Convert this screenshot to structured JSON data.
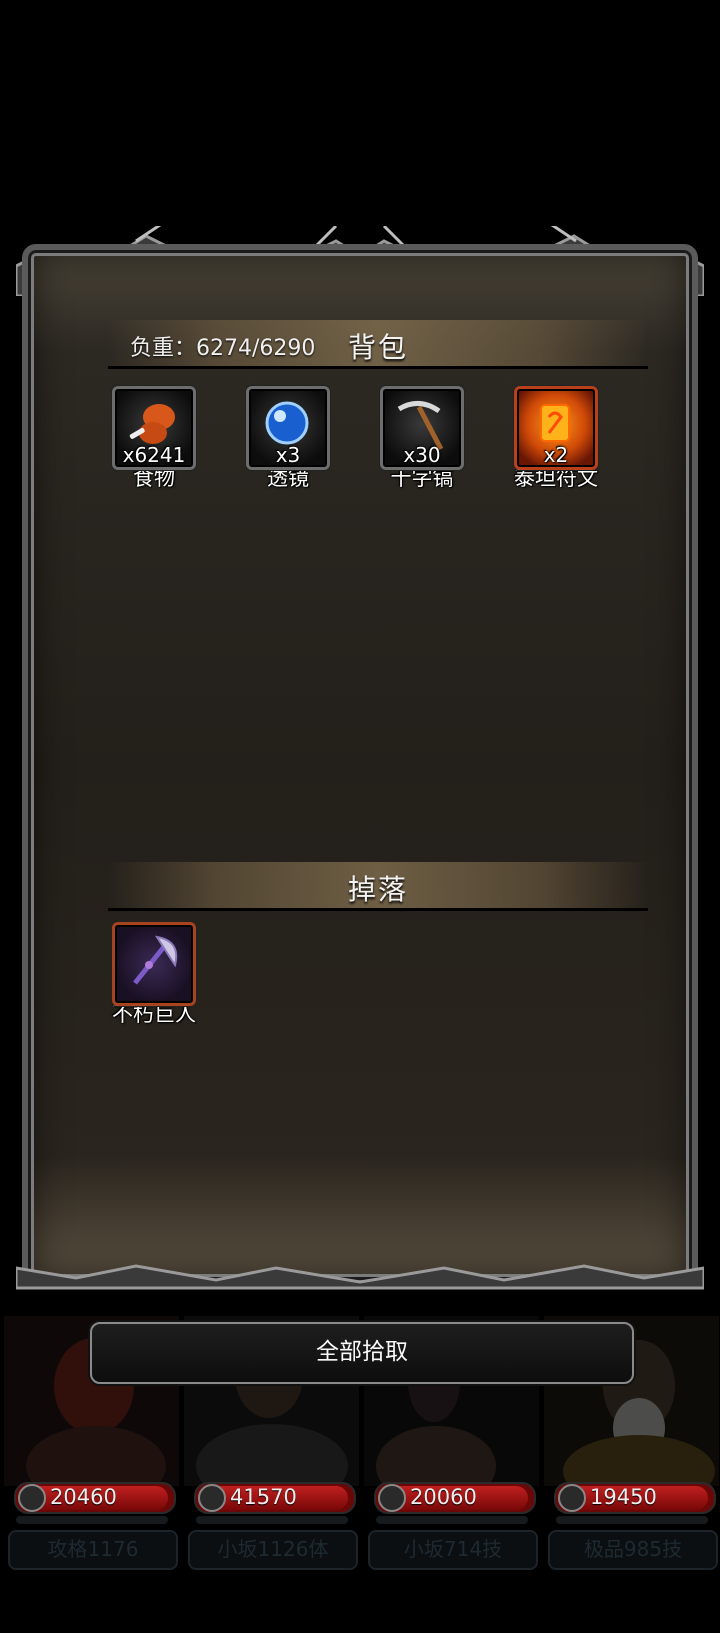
{
  "backpack": {
    "load_label": "负重：6274/6290",
    "title": "背包",
    "items": [
      {
        "name": "食物",
        "count": "x6241",
        "icon": "drumstick-icon"
      },
      {
        "name": "透镜",
        "count": "x3",
        "icon": "lens-orb-icon"
      },
      {
        "name": "十字镐",
        "count": "x30",
        "icon": "pickaxe-icon"
      },
      {
        "name": "泰坦符文",
        "count": "x2",
        "icon": "rune-icon"
      }
    ]
  },
  "drops": {
    "title": "掉落",
    "items": [
      {
        "name": "不朽巨人",
        "icon": "axe-weapon-icon"
      }
    ]
  },
  "pickup_all_label": "全部拾取",
  "heroes": [
    {
      "hp": "20460",
      "name": "攻格1176"
    },
    {
      "hp": "41570",
      "name": "小坂1126体"
    },
    {
      "hp": "20060",
      "name": "小坂714技"
    },
    {
      "hp": "19450",
      "name": "极品985技"
    }
  ],
  "colors": {
    "background": "#000000",
    "hp_bar": "#c02020",
    "rune_slot": "#d04a08"
  }
}
